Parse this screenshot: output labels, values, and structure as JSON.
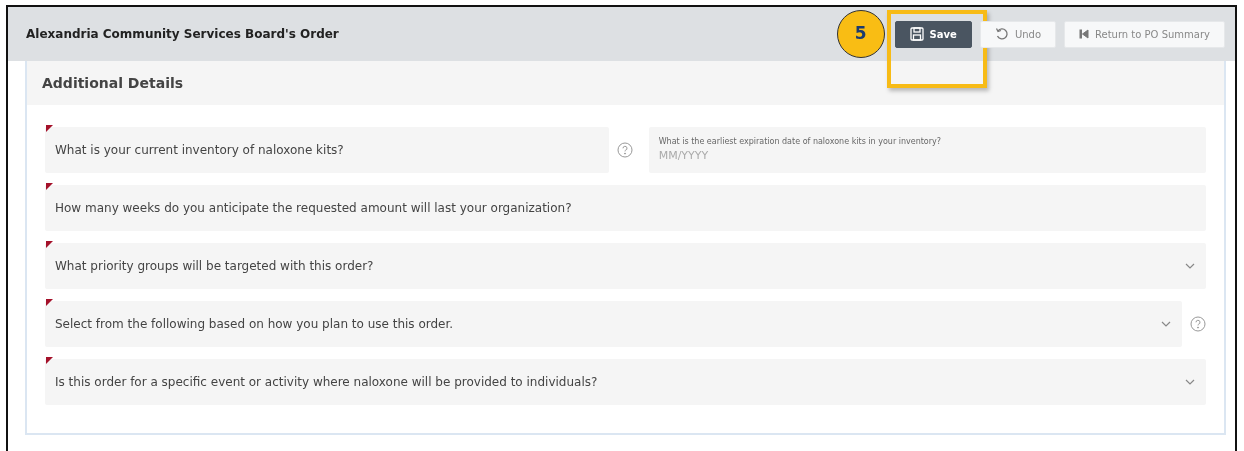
{
  "header": {
    "title": "Alexandria Community Services Board's Order"
  },
  "callout": {
    "number": "5"
  },
  "buttons": [
    {
      "label": "Save",
      "kind": "save",
      "highlighted": true
    },
    {
      "label": "Undo",
      "kind": "undo",
      "highlighted": false
    },
    {
      "label": "Return to PO Summary",
      "kind": "return",
      "highlighted": false
    }
  ],
  "section": {
    "title": "Additional Details"
  },
  "rows": [
    {
      "fields": [
        {
          "kind": "text",
          "placeholder": "What is your current inventory of naloxone kits?",
          "required": true,
          "help": true
        },
        {
          "kind": "date",
          "label": "What is the earliest expiration date of naloxone kits in your inventory?",
          "placeholder": "MM/YYYY",
          "required": false,
          "help": false
        }
      ]
    },
    {
      "fields": [
        {
          "kind": "text",
          "placeholder": "How many weeks do you anticipate the requested amount will last your organization?",
          "required": true,
          "help": false
        }
      ]
    },
    {
      "fields": [
        {
          "kind": "select",
          "placeholder": "What priority groups will be targeted with this order?",
          "required": true,
          "help": false
        }
      ]
    },
    {
      "fields": [
        {
          "kind": "select",
          "placeholder": "Select from the following based on how you plan to use this order.",
          "required": true,
          "help": true
        }
      ]
    },
    {
      "fields": [
        {
          "kind": "select",
          "placeholder": "Is this order for a specific event or activity where naloxone will be provided to individuals?",
          "required": true,
          "help": false
        }
      ]
    }
  ]
}
